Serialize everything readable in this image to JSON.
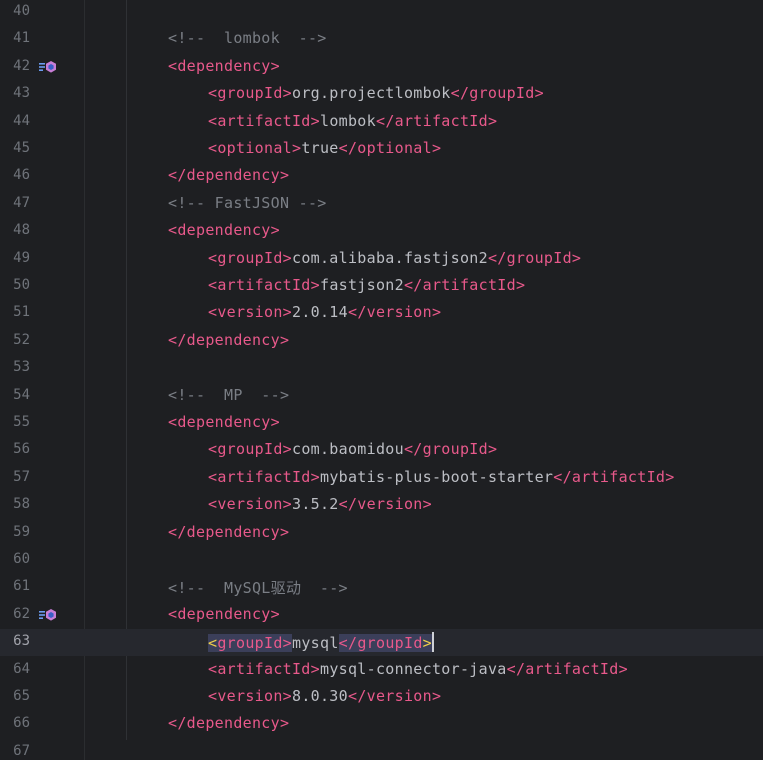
{
  "editor": {
    "lines": [
      {
        "n": "40",
        "kind": "blank"
      },
      {
        "n": "41",
        "kind": "comment",
        "text": "<!--  lombok  -->"
      },
      {
        "n": "42",
        "kind": "open",
        "tag": "dependency",
        "icon": true
      },
      {
        "n": "43",
        "kind": "elem",
        "tag": "groupId",
        "value": "org.projectlombok"
      },
      {
        "n": "44",
        "kind": "elem",
        "tag": "artifactId",
        "value": "lombok"
      },
      {
        "n": "45",
        "kind": "elem",
        "tag": "optional",
        "value": "true"
      },
      {
        "n": "46",
        "kind": "close",
        "tag": "dependency"
      },
      {
        "n": "47",
        "kind": "comment",
        "text": "<!-- FastJSON -->"
      },
      {
        "n": "48",
        "kind": "open",
        "tag": "dependency"
      },
      {
        "n": "49",
        "kind": "elem",
        "tag": "groupId",
        "value": "com.alibaba.fastjson2"
      },
      {
        "n": "50",
        "kind": "elem",
        "tag": "artifactId",
        "value": "fastjson2"
      },
      {
        "n": "51",
        "kind": "elem",
        "tag": "version",
        "value": "2.0.14"
      },
      {
        "n": "52",
        "kind": "close",
        "tag": "dependency"
      },
      {
        "n": "53",
        "kind": "blank"
      },
      {
        "n": "54",
        "kind": "comment",
        "text": "<!--  MP  -->"
      },
      {
        "n": "55",
        "kind": "open",
        "tag": "dependency"
      },
      {
        "n": "56",
        "kind": "elem",
        "tag": "groupId",
        "value": "com.baomidou"
      },
      {
        "n": "57",
        "kind": "elem",
        "tag": "artifactId",
        "value": "mybatis-plus-boot-starter"
      },
      {
        "n": "58",
        "kind": "elem",
        "tag": "version",
        "value": "3.5.2"
      },
      {
        "n": "59",
        "kind": "close",
        "tag": "dependency"
      },
      {
        "n": "60",
        "kind": "blank"
      },
      {
        "n": "61",
        "kind": "comment",
        "text": "<!--  MySQL驱动  -->"
      },
      {
        "n": "62",
        "kind": "open",
        "tag": "dependency",
        "icon": true
      },
      {
        "n": "63",
        "kind": "elem",
        "tag": "groupId",
        "value": "mysql",
        "current": true
      },
      {
        "n": "64",
        "kind": "elem",
        "tag": "artifactId",
        "value": "mysql-connector-java"
      },
      {
        "n": "65",
        "kind": "elem",
        "tag": "version",
        "value": "8.0.30"
      },
      {
        "n": "66",
        "kind": "close",
        "tag": "dependency"
      },
      {
        "n": "67",
        "kind": "blank"
      }
    ]
  },
  "icons": {
    "gutter": "maven-dependency-icon"
  },
  "colors": {
    "background": "#1e1f22",
    "tag": "#e8598b",
    "text": "#bcbec4",
    "comment": "#7a7e85",
    "line_number": "#6f737a",
    "current_line": "#26282e"
  }
}
